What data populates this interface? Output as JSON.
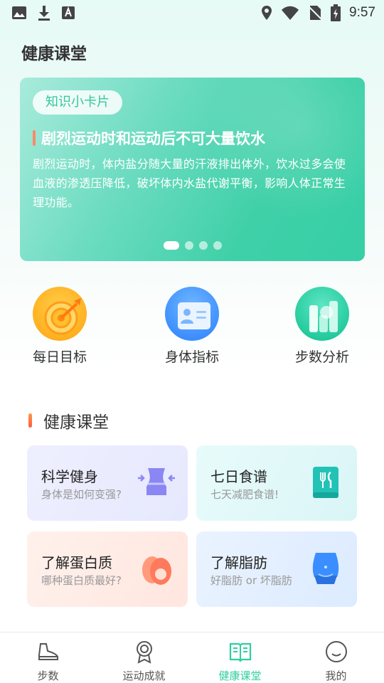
{
  "status_bar": {
    "time": "9:57"
  },
  "page_title": "健康课堂",
  "banner": {
    "tag": "知识小卡片",
    "title": "剧烈运动时和运动后不可大量饮水",
    "body": "剧烈运动时，体内盐分随大量的汗液排出体外，饮水过多会使血液的渗透压降低，破坏体内水盐代谢平衡，影响人体正常生理功能。",
    "page_count": 4,
    "active_page": 1
  },
  "quick_actions": [
    {
      "label": "每日目标",
      "icon": "target-icon"
    },
    {
      "label": "身体指标",
      "icon": "id-card-icon"
    },
    {
      "label": "步数分析",
      "icon": "bar-chart-icon"
    }
  ],
  "section": {
    "title": "健康课堂"
  },
  "cards": [
    {
      "title": "科学健身",
      "subtitle": "身体是如何变强?",
      "icon": "waist-icon"
    },
    {
      "title": "七日食谱",
      "subtitle": "七天减肥食谱!",
      "icon": "recipe-book-icon"
    },
    {
      "title": "了解蛋白质",
      "subtitle": "哪种蛋白质最好?",
      "icon": "egg-icon"
    },
    {
      "title": "了解脂肪",
      "subtitle": "好脂肪 or 坏脂肪",
      "icon": "belly-icon"
    }
  ],
  "bottom_nav": [
    {
      "label": "步数",
      "icon": "shoe-icon",
      "active": false
    },
    {
      "label": "运动成就",
      "icon": "medal-icon",
      "active": false
    },
    {
      "label": "健康课堂",
      "icon": "book-icon",
      "active": true
    },
    {
      "label": "我的",
      "icon": "smiley-icon",
      "active": false
    }
  ],
  "colors": {
    "accent": "#2fcf9f",
    "section_bar": "#ff6a3a"
  }
}
